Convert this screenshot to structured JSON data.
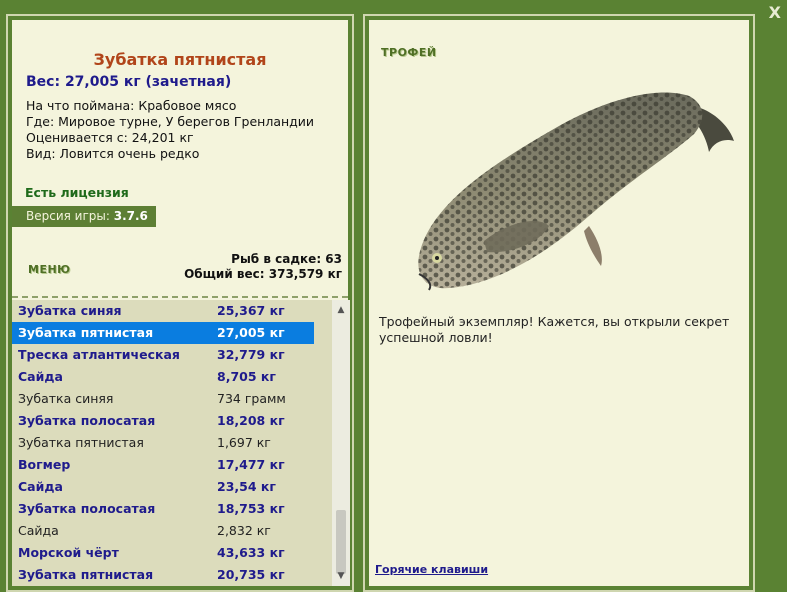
{
  "window": {
    "close_label": "X"
  },
  "fish": {
    "title": "Зубатка пятнистая",
    "weight_line": "Вес: 27,005 кг (зачетная)",
    "info": [
      "На что поймана: Крабовое мясо",
      "Где: Мировое турне, У берегов Гренландии",
      "Оценивается с: 24,201 кг",
      "Вид: Ловится очень редко"
    ]
  },
  "license_label": "Есть лицензия",
  "version": {
    "label": "Версия игры:",
    "value": "3.7.6"
  },
  "menu_label": "МЕНЮ",
  "keepnet": {
    "count_line": "Рыб в садке: 63",
    "total_line": "Общий вес: 373,579 кг"
  },
  "catch_list": [
    {
      "name": "Зубатка синяя",
      "weight": "25,367 кг",
      "style": "bold"
    },
    {
      "name": "Зубатка пятнистая",
      "weight": "27,005 кг",
      "style": "selected"
    },
    {
      "name": "Треска атлантическая",
      "weight": "32,779 кг",
      "style": "bold"
    },
    {
      "name": "Сайда",
      "weight": "8,705 кг",
      "style": "bold"
    },
    {
      "name": "Зубатка синяя",
      "weight": "734 грамм",
      "style": "plain"
    },
    {
      "name": "Зубатка полосатая",
      "weight": "18,208 кг",
      "style": "bold"
    },
    {
      "name": "Зубатка пятнистая",
      "weight": "1,697 кг",
      "style": "plain"
    },
    {
      "name": "Вогмер",
      "weight": "17,477 кг",
      "style": "bold"
    },
    {
      "name": "Сайда",
      "weight": "23,54 кг",
      "style": "bold"
    },
    {
      "name": "Зубатка полосатая",
      "weight": "18,753 кг",
      "style": "bold"
    },
    {
      "name": "Сайда",
      "weight": "2,832 кг",
      "style": "plain"
    },
    {
      "name": "Морской чёрт",
      "weight": "43,633 кг",
      "style": "bold"
    },
    {
      "name": "Зубатка пятнистая",
      "weight": "20,735 кг",
      "style": "bold"
    }
  ],
  "trophy": {
    "label": "ТРОФЕЙ",
    "text": "Трофейный экземпляр! Кажется, вы открыли секрет успешной ловли!"
  },
  "hotkeys_label": "Горячие клавиши",
  "colors": {
    "background": "#5a8233",
    "panel": "#f4f4dc",
    "title": "#b1451a",
    "accent_text": "#1f1b8c",
    "selected_row": "#0a7de0",
    "license": "#1f6a1a"
  }
}
